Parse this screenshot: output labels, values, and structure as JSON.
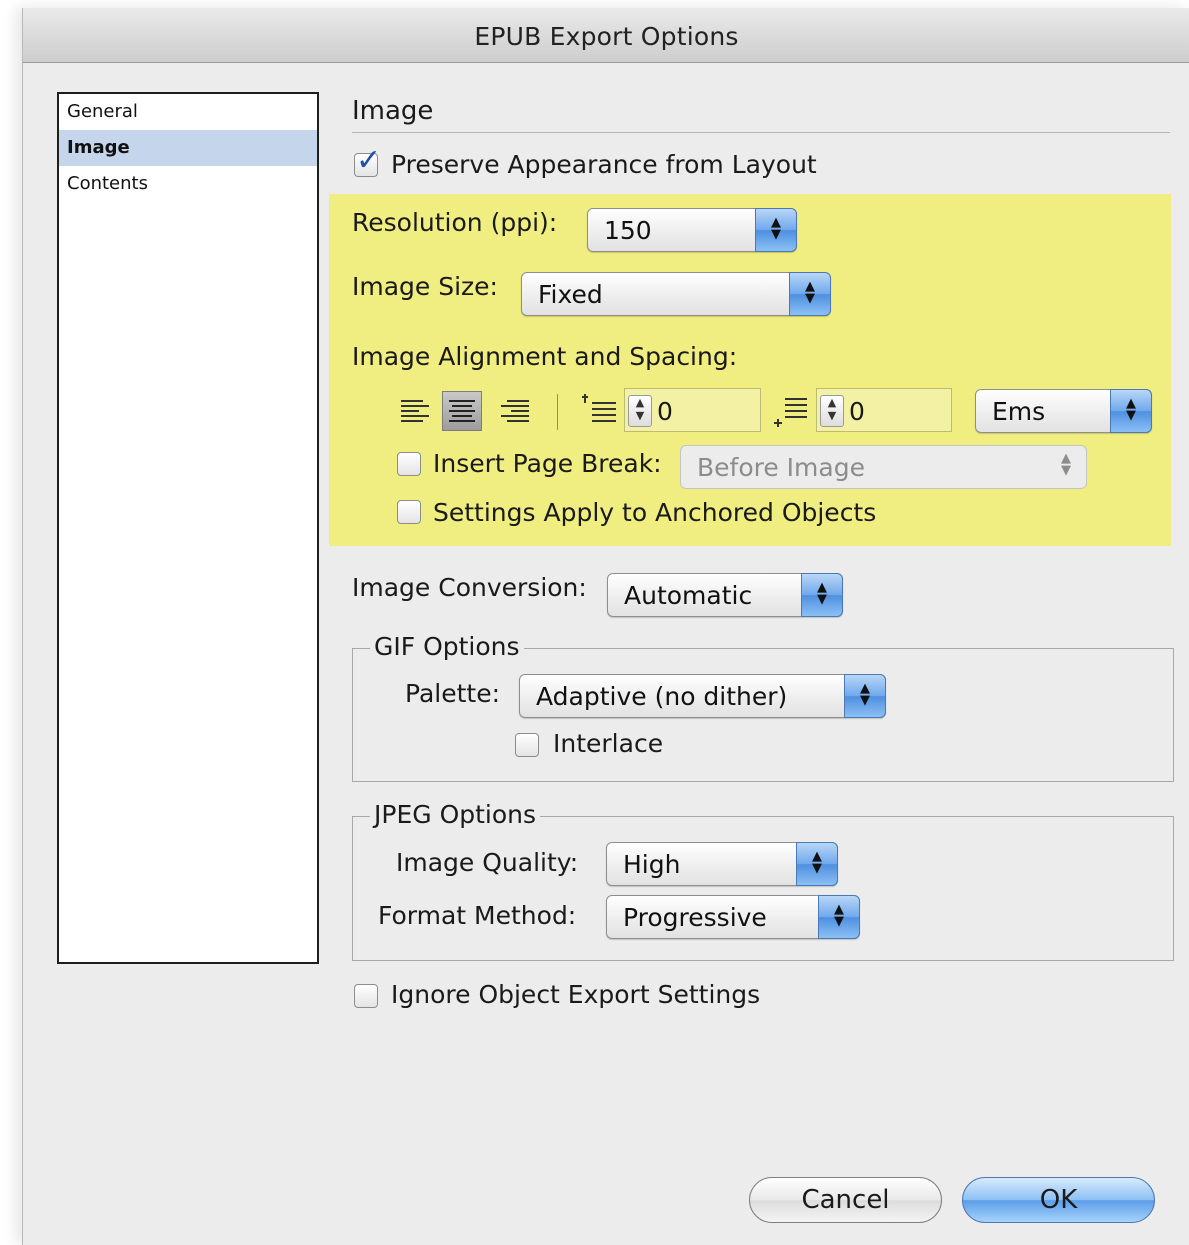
{
  "window": {
    "title": "EPUB Export Options"
  },
  "sidebar": {
    "items": [
      {
        "label": "General"
      },
      {
        "label": "Image"
      },
      {
        "label": "Contents"
      }
    ]
  },
  "image_section": {
    "title": "Image",
    "preserve_appearance": {
      "label": "Preserve Appearance from Layout",
      "checked": true
    },
    "resolution": {
      "label": "Resolution (ppi):",
      "value": "150"
    },
    "image_size": {
      "label": "Image Size:",
      "value": "Fixed"
    },
    "alignment": {
      "label": "Image Alignment and Spacing:",
      "space_before": "0",
      "space_after": "0",
      "units": "Ems"
    },
    "insert_page_break": {
      "label": "Insert Page Break:",
      "checked": false,
      "value": "Before Image"
    },
    "anchored_objects": {
      "label": "Settings Apply to Anchored Objects",
      "checked": false
    },
    "conversion": {
      "label": "Image Conversion:",
      "value": "Automatic"
    }
  },
  "gif_options": {
    "title": "GIF Options",
    "palette_label": "Palette:",
    "palette_value": "Adaptive (no dither)",
    "interlace_label": "Interlace",
    "interlace_checked": false
  },
  "jpeg_options": {
    "title": "JPEG Options",
    "quality_label": "Image Quality:",
    "quality_value": "High",
    "format_label": "Format Method:",
    "format_value": "Progressive"
  },
  "ignore_export": {
    "label": "Ignore Object Export Settings",
    "checked": false
  },
  "buttons": {
    "cancel": "Cancel",
    "ok": "OK"
  },
  "colors": {
    "highlight": "#f0ee80",
    "selection": "#c5d6ec",
    "accent": "#5c9de9"
  }
}
